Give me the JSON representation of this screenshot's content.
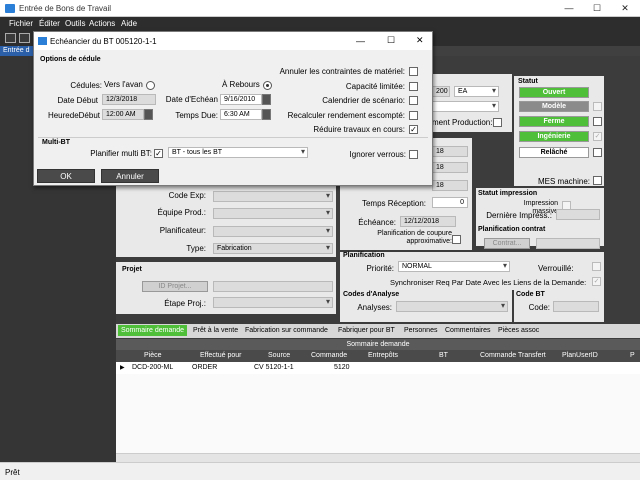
{
  "window": {
    "title": "Entrée de Bons de Travail",
    "minimize": "—",
    "maximize": "☐",
    "close": "✕"
  },
  "menu": [
    "Fichier",
    "Éditer",
    "Outils",
    "Actions",
    "Aide"
  ],
  "tree_strip": "Entrée d",
  "dialog": {
    "title": "Echéancier du BT 005120-1-1",
    "options_section": "Options de cédule",
    "cedules_label": "Cédules:",
    "radio_avant": "Vers l'avan",
    "radio_rebours": "À Rebours",
    "date_debut_label": "Date Début",
    "date_debut": "12/3/2018",
    "heure_debut_label": "HeuredeDébut",
    "heure_debut": "12:00 AM",
    "date_echeance_label": "Date d'Echéan",
    "date_echeance": "9/16/2010",
    "temps_du_label": "Temps Due:",
    "temps_du": "6:30 AM",
    "annuler_contraintes": "Annuler les contraintes de matériel:",
    "capacite_limitee": "Capacité limitée:",
    "calendrier_scenario": "Calendrier de scénario:",
    "recalculer_rendement": "Recalculer rendement escompté:",
    "reduire_travaux": "Réduire travaux en cours:",
    "multi_section": "Multi-BT",
    "planifier_multi_label": "Planifier multi BT:",
    "planifier_multi_value": "BT - tous les BT",
    "ignorer_verrous": "Ignorer verrous:",
    "ok": "OK",
    "cancel": "Annuler"
  },
  "form": {
    "qty_value": "200",
    "unit_value": "EA",
    "ment_production": "ment Production:",
    "val18a": "18",
    "val18b": "18",
    "val18c": "18",
    "code_exp": "Code Exp:",
    "equipe_prod": "Équipe Prod.:",
    "planificateur": "Planificateur:",
    "type_label": "Type:",
    "type_value": "Fabrication",
    "projet_section": "Projet",
    "id_projet_btn": "ID Projet...",
    "etape_proj": "Étape Proj.:",
    "temps_reception": "Temps Réception:",
    "temps_reception_val": "0",
    "echeance_label": "Échéance:",
    "echeance_val": "12/12/2018",
    "planif_coupure": "Planification de coupure approximative:",
    "planification_section": "Planification",
    "priorite_label": "Priorité:",
    "priorite_val": "NORMAL",
    "verrouille": "Verrouillé:",
    "synchroniser": "Synchroniser Req Par Date Avec les Liens de la Demande:",
    "codes_analyse_section": "Codes d'Analyse",
    "analyses_label": "Analyses:",
    "code_bt_section": "Code BT",
    "code_label": "Code:"
  },
  "statut": {
    "title": "Statut",
    "buttons": [
      "Ouvert",
      "Modèle",
      "Ferme",
      "Ingénierie",
      "Relâché"
    ],
    "mes_machine": "MES machine:",
    "statut_impression": "Statut impression",
    "impression_massive": "Impression massive",
    "derniere_impress": "Dernière Impress.:",
    "planif_contrat": "Planification contrat",
    "contrat_btn": "Contrat..."
  },
  "tabs": [
    "Sommaire demande",
    "Prêt à la vente",
    "Fabrication sur commande",
    "Fabriquer pour BT",
    "Personnes",
    "Commentaires",
    "Pièces assoc"
  ],
  "grid": {
    "title": "Sommaire demande",
    "columns": [
      "Pièce",
      "Effectué pour",
      "Source",
      "Commande",
      "Entrepôts",
      "BT",
      "Commande Transfert",
      "PlanUserID",
      "P"
    ],
    "rows": [
      [
        "DCD-200-ML",
        "ORDER",
        "CV 5120-1-1",
        "5120",
        "",
        "",
        "",
        "",
        ""
      ]
    ]
  },
  "status_bar": "Prêt",
  "colors": {
    "accent_green": "#4fbf3a",
    "dark_bg": "#2d2d2d",
    "selection_blue": "#2b5fa8"
  }
}
